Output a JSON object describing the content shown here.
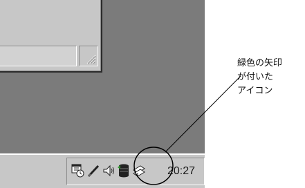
{
  "taskbar": {
    "tray_icons": [
      {
        "name": "scheduler-icon"
      },
      {
        "name": "pen-icon"
      },
      {
        "name": "speaker-icon"
      },
      {
        "name": "green-arrow-app-icon"
      },
      {
        "name": "network-icon"
      }
    ],
    "clock": "20:27"
  },
  "annotation": {
    "text": "緑色の矢印\nが付いた\nアイコン"
  },
  "colors": {
    "desktop": "#7b7b7b",
    "panel": "#c7c7c7",
    "annotation_line": "#000000"
  }
}
